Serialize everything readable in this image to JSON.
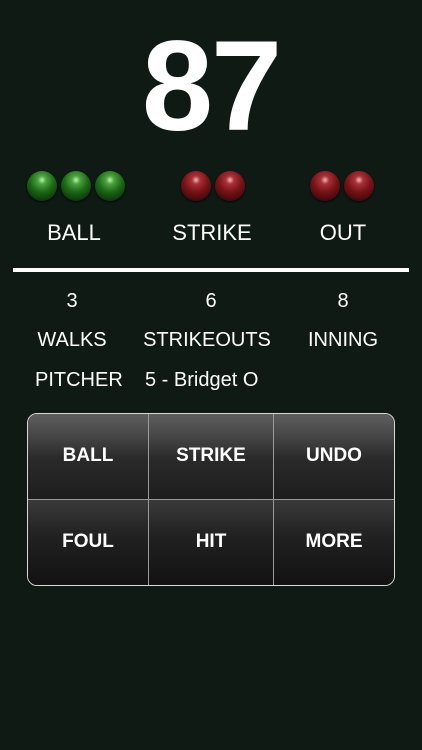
{
  "scoreboard": {
    "pitch_count": "87"
  },
  "count": {
    "ball": {
      "label": "BALL",
      "lights_on": 3,
      "color": "#1d6b17"
    },
    "strike": {
      "label": "STRIKE",
      "lights_on": 2,
      "color": "#7a1418"
    },
    "out": {
      "label": "OUT",
      "lights_on": 2,
      "color": "#7a1418"
    }
  },
  "stats": {
    "walks": {
      "value": "3",
      "label": "WALKS"
    },
    "strikeouts": {
      "value": "6",
      "label": "STRIKEOUTS"
    },
    "inning": {
      "value": "8",
      "label": "INNING"
    }
  },
  "pitcher": {
    "label": "PITCHER",
    "name": "5 - Bridget O"
  },
  "pad": {
    "ball": "BALL",
    "strike": "STRIKE",
    "undo": "UNDO",
    "foul": "FOUL",
    "hit": "HIT",
    "more": "MORE"
  }
}
